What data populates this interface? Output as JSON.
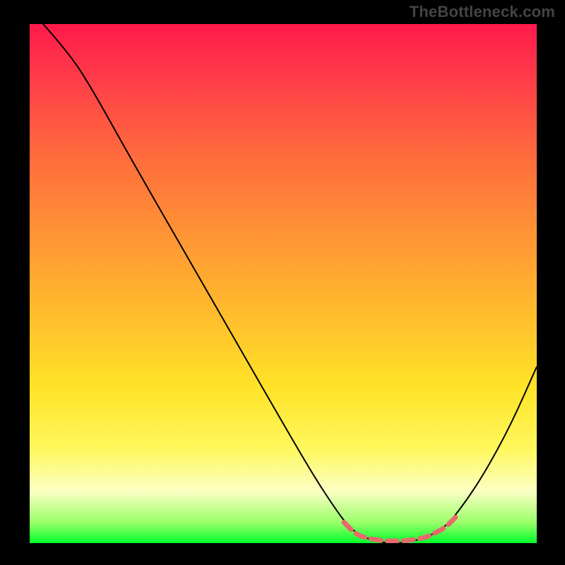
{
  "attribution": "TheBottleneck.com",
  "chart_data": {
    "type": "line",
    "title": "",
    "xlabel": "",
    "ylabel": "",
    "x_range": [
      0,
      100
    ],
    "y_range": [
      0,
      100
    ],
    "series": [
      {
        "name": "curve",
        "stroke": "#000000",
        "stroke_width": 2,
        "points": [
          {
            "x": 0,
            "y": 103
          },
          {
            "x": 8,
            "y": 94
          },
          {
            "x": 12,
            "y": 88
          },
          {
            "x": 20,
            "y": 74
          },
          {
            "x": 30,
            "y": 57
          },
          {
            "x": 40,
            "y": 40
          },
          {
            "x": 50,
            "y": 23
          },
          {
            "x": 56,
            "y": 13
          },
          {
            "x": 60,
            "y": 7
          },
          {
            "x": 63,
            "y": 3
          },
          {
            "x": 66,
            "y": 1
          },
          {
            "x": 70,
            "y": 0
          },
          {
            "x": 74,
            "y": 0
          },
          {
            "x": 78,
            "y": 1
          },
          {
            "x": 82,
            "y": 3
          },
          {
            "x": 86,
            "y": 8
          },
          {
            "x": 90,
            "y": 14
          },
          {
            "x": 95,
            "y": 23
          },
          {
            "x": 100,
            "y": 34
          }
        ]
      },
      {
        "name": "highlight-band",
        "stroke": "#e76b6b",
        "stroke_width": 7,
        "dash": "14 9",
        "points": [
          {
            "x": 62,
            "y": 4.0
          },
          {
            "x": 64,
            "y": 2.0
          },
          {
            "x": 66,
            "y": 1.0
          },
          {
            "x": 70,
            "y": 0.4
          },
          {
            "x": 74,
            "y": 0.4
          },
          {
            "x": 78,
            "y": 1.0
          },
          {
            "x": 80,
            "y": 2.0
          },
          {
            "x": 82,
            "y": 3.0
          },
          {
            "x": 84,
            "y": 5.0
          }
        ]
      }
    ],
    "gradient_stops": [
      {
        "pos": 0,
        "color": "#ff1a4b"
      },
      {
        "pos": 50,
        "color": "#ffb22e"
      },
      {
        "pos": 82,
        "color": "#fff85f"
      },
      {
        "pos": 100,
        "color": "#00ff2b"
      }
    ]
  }
}
